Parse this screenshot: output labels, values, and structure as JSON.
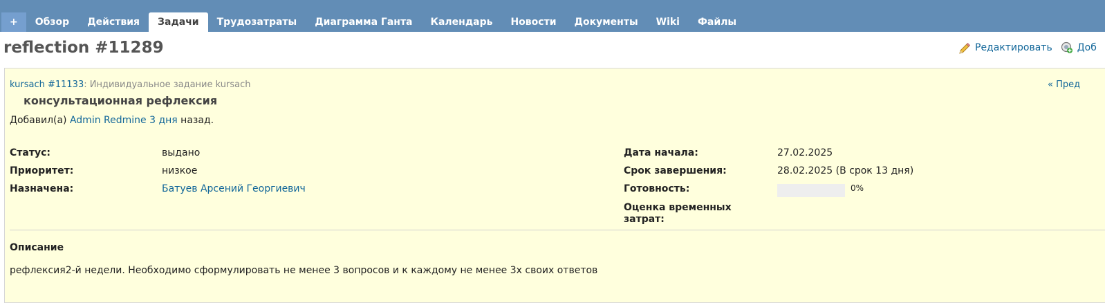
{
  "nav": {
    "tabs": [
      {
        "label": "+"
      },
      {
        "label": "Обзор"
      },
      {
        "label": "Действия"
      },
      {
        "label": "Задачи"
      },
      {
        "label": "Трудозатраты"
      },
      {
        "label": "Диаграмма Ганта"
      },
      {
        "label": "Календарь"
      },
      {
        "label": "Новости"
      },
      {
        "label": "Документы"
      },
      {
        "label": "Wiki"
      },
      {
        "label": "Файлы"
      }
    ],
    "selected": "Задачи"
  },
  "header": {
    "title": "reflection #11289",
    "edit_label": "Редактировать",
    "add_label": "Доб"
  },
  "issue": {
    "parent_link": "kursach #11133",
    "parent_suffix": ": Индивидуальное задание kursach",
    "prev_label": "« Пред",
    "subject": "консультационная рефлексия",
    "added_prefix": "Добавил(а) ",
    "author": "Admin Redmine",
    "age": "3 дня",
    "added_suffix": " назад.",
    "status_label": "Статус:",
    "status_value": "выдано",
    "priority_label": "Приоритет:",
    "priority_value": "низкое",
    "assignee_label": "Назначена:",
    "assignee_value": "Батуев Арсений Георгиевич",
    "start_label": "Дата начала:",
    "start_value": "27.02.2025",
    "due_label": "Срок завершения:",
    "due_value": "28.02.2025 (В срок 13 дня)",
    "done_label": "Готовность:",
    "done_value": "0%",
    "done_ratio": 0,
    "estimate_label_1": "Оценка временных",
    "estimate_label_2": "затрат:",
    "description_label": "Описание",
    "description_text": "рефлексия2-й недели. Необходимо сформулировать не менее 3 вопросов и к каждому не менее 3х своих ответов"
  },
  "colors": {
    "nav_bg": "#628db6",
    "box_bg": "#ffffdd",
    "link": "#116699"
  }
}
